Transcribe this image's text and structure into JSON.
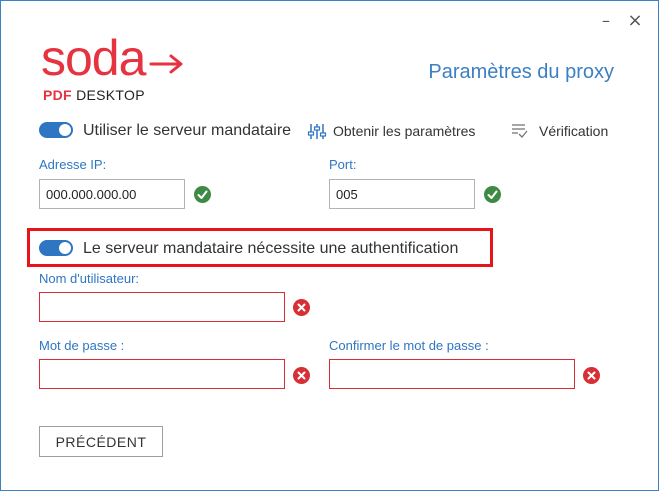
{
  "window": {
    "minimize_glyph": "–",
    "close_glyph": "×"
  },
  "logo": {
    "wordmark": "soda",
    "sub_pdf": "PDF",
    "sub_desktop": "DESKTOP",
    "color": "#e63340"
  },
  "header": {
    "title": "Paramètres du proxy"
  },
  "proxy": {
    "toggle_label": "Utiliser le serveur mandataire",
    "toggle_on": true,
    "get_settings_label": "Obtenir les paramètres",
    "get_settings_icon": "sliders-icon",
    "verify_label": "Vérification",
    "verify_icon": "verify-list-icon",
    "ip_label": "Adresse IP:",
    "ip_value": "000.000.000.00",
    "port_label": "Port:",
    "port_value": "005"
  },
  "auth": {
    "toggle_label": "Le serveur mandataire nécessite une authentification",
    "toggle_on": true,
    "username_label": "Nom d'utilisateur:",
    "username_value": "",
    "password_label": "Mot de passe :",
    "password_value": "",
    "confirm_label": "Confirmer le mot de passe :",
    "confirm_value": ""
  },
  "footer": {
    "back_label": "PRÉCÉDENT"
  },
  "colors": {
    "accent": "#2e76c2",
    "success": "#3e8a44",
    "error": "#d62f35",
    "highlight": "#e8141b"
  }
}
